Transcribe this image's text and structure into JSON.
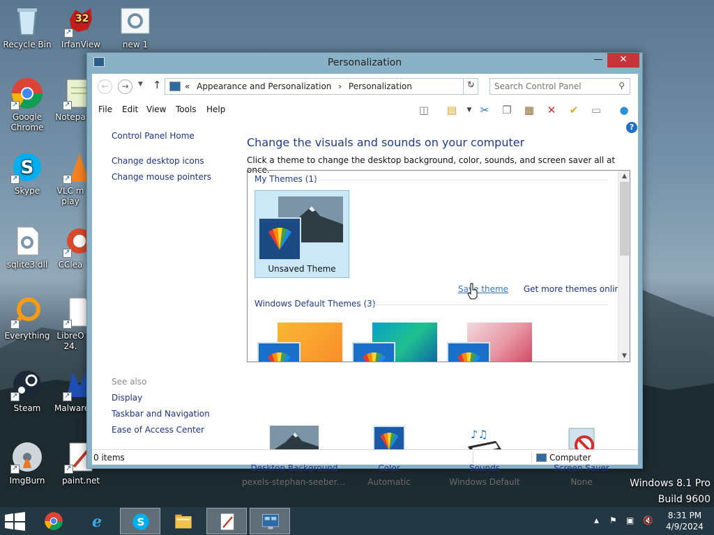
{
  "desktop": {
    "icons": [
      {
        "label": "Recycle Bin"
      },
      {
        "label": "IrfanView",
        "badge": "32"
      },
      {
        "label": "new 1"
      },
      {
        "label": "Google Chrome"
      },
      {
        "label": "Notepa"
      },
      {
        "label": "Skype"
      },
      {
        "label": "VLC m play"
      },
      {
        "label": "sqlite3.dll"
      },
      {
        "label": "CClea"
      },
      {
        "label": "Everything"
      },
      {
        "label": "LibreO 24."
      },
      {
        "label": "Steam"
      },
      {
        "label": "Malware"
      },
      {
        "label": "ImgBurn"
      },
      {
        "label": "paint.net"
      }
    ],
    "watermark": {
      "line1": "Windows 8.1 Pro",
      "line2": "Build 9600"
    }
  },
  "window": {
    "title": "Personalization",
    "controls": {
      "minimize": "—",
      "maximize": "☐",
      "close": "✕"
    },
    "address": {
      "prefix": "«",
      "crumbs": [
        "Appearance and Personalization",
        "›",
        "Personalization"
      ],
      "search_placeholder": "Search Control Panel"
    },
    "menu": [
      "File",
      "Edit",
      "View",
      "Tools",
      "Help"
    ],
    "left_pane": {
      "home": "Control Panel Home",
      "links": [
        "Change desktop icons",
        "Change mouse pointers"
      ],
      "see_also_label": "See also",
      "see_also": [
        "Display",
        "Taskbar and Navigation",
        "Ease of Access Center"
      ]
    },
    "content": {
      "heading": "Change the visuals and sounds on your computer",
      "description": "Click a theme to change the desktop background, color, sounds, and screen saver all at once.",
      "my_themes_header": "My Themes (1)",
      "unsaved_theme_label": "Unsaved Theme",
      "save_theme_link": "Save theme",
      "more_themes_link": "Get more themes online",
      "default_themes_header": "Windows Default Themes (3)"
    },
    "bottom_items": [
      {
        "title": "Desktop Background",
        "subtitle": "pexels-stephan-seeber-..."
      },
      {
        "title": "Color",
        "subtitle": "Automatic"
      },
      {
        "title": "Sounds",
        "subtitle": "Windows Default"
      },
      {
        "title": "Screen Saver",
        "subtitle": "None"
      }
    ],
    "status": {
      "items": "0 items",
      "location": "Computer"
    }
  },
  "taskbar": {
    "clock_time": "8:31 PM",
    "clock_date": "4/9/2024",
    "tray_arrow": "▲"
  },
  "colors": {
    "accent_link": "#1e3287",
    "heading": "#1e3b8a",
    "window_frame": "#8ab2c6",
    "close_button": "#c7353a",
    "selection": "#cbe8f6"
  }
}
